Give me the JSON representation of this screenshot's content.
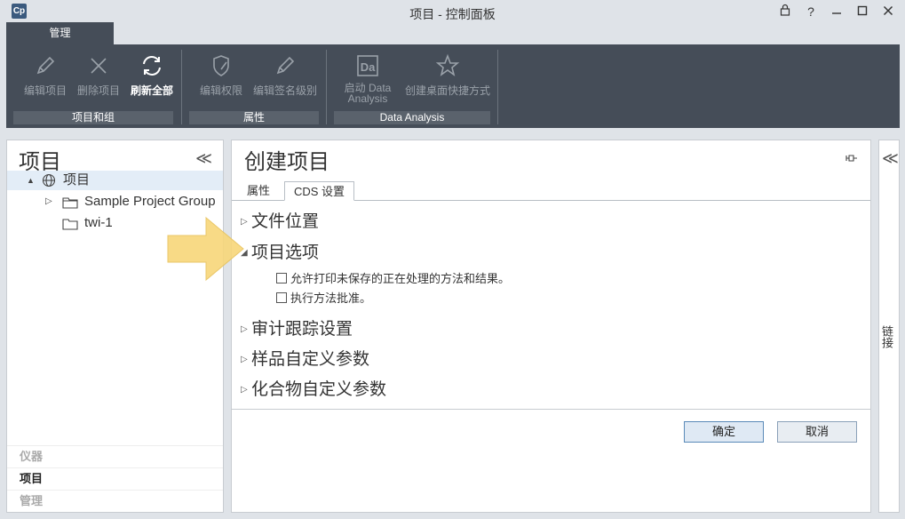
{
  "window": {
    "title": "项目 - 控制面板",
    "logo": "Cp",
    "buttons": [
      "lock-icon",
      "help-icon",
      "minimize-icon",
      "maximize-icon",
      "close-icon"
    ],
    "help_glyph": "?"
  },
  "ribbon": {
    "tab": "管理",
    "groups": [
      {
        "label": "项目和组",
        "buttons": [
          {
            "label": "编辑项目",
            "icon": "pencil-icon"
          },
          {
            "label": "删除项目",
            "icon": "x-icon"
          },
          {
            "label": "刷新全部",
            "icon": "refresh-icon"
          }
        ]
      },
      {
        "label": "属性",
        "buttons": [
          {
            "label": "编辑权限",
            "icon": "shield-pencil-icon"
          },
          {
            "label": "编辑签名级别",
            "icon": "pencil-icon"
          }
        ]
      },
      {
        "label": "Data Analysis",
        "buttons": [
          {
            "label": "启动 Data Analysis",
            "icon": "data-analysis-icon",
            "icon_text": "Da"
          },
          {
            "label": "创建桌面快捷方式",
            "icon": "star-icon"
          }
        ]
      }
    ]
  },
  "left_panel": {
    "title": "项目",
    "tree": [
      {
        "label": "项目",
        "icon": "globe-icon",
        "expander": "▲"
      },
      {
        "label": "Sample Project Group",
        "icon": "folder-icon",
        "expander": "▷"
      },
      {
        "label": "twi-1",
        "icon": "folder-icon"
      }
    ],
    "footer": [
      {
        "label": "仪器"
      },
      {
        "label": "项目"
      },
      {
        "label": "管理"
      }
    ]
  },
  "main_panel": {
    "title": "创建项目",
    "tabs": [
      "属性",
      "CDS 设置"
    ],
    "sections": [
      {
        "label": "文件位置",
        "expanded": false
      },
      {
        "label": "项目选项",
        "expanded": true
      },
      {
        "label": "审计跟踪设置",
        "expanded": false
      },
      {
        "label": "样品自定义参数",
        "expanded": false
      },
      {
        "label": "化合物自定义参数",
        "expanded": false
      }
    ],
    "options": [
      {
        "label": "允许打印未保存的正在处理的方法和结果。",
        "checked": false
      },
      {
        "label": "执行方法批准。",
        "checked": false
      }
    ],
    "buttons": {
      "ok": "确定",
      "cancel": "取消"
    }
  },
  "right_panel": {
    "label": "链接"
  },
  "colors": {
    "ribbon": "#454d58",
    "arrow": "#f8d77a",
    "selection": "#e3edf7"
  }
}
